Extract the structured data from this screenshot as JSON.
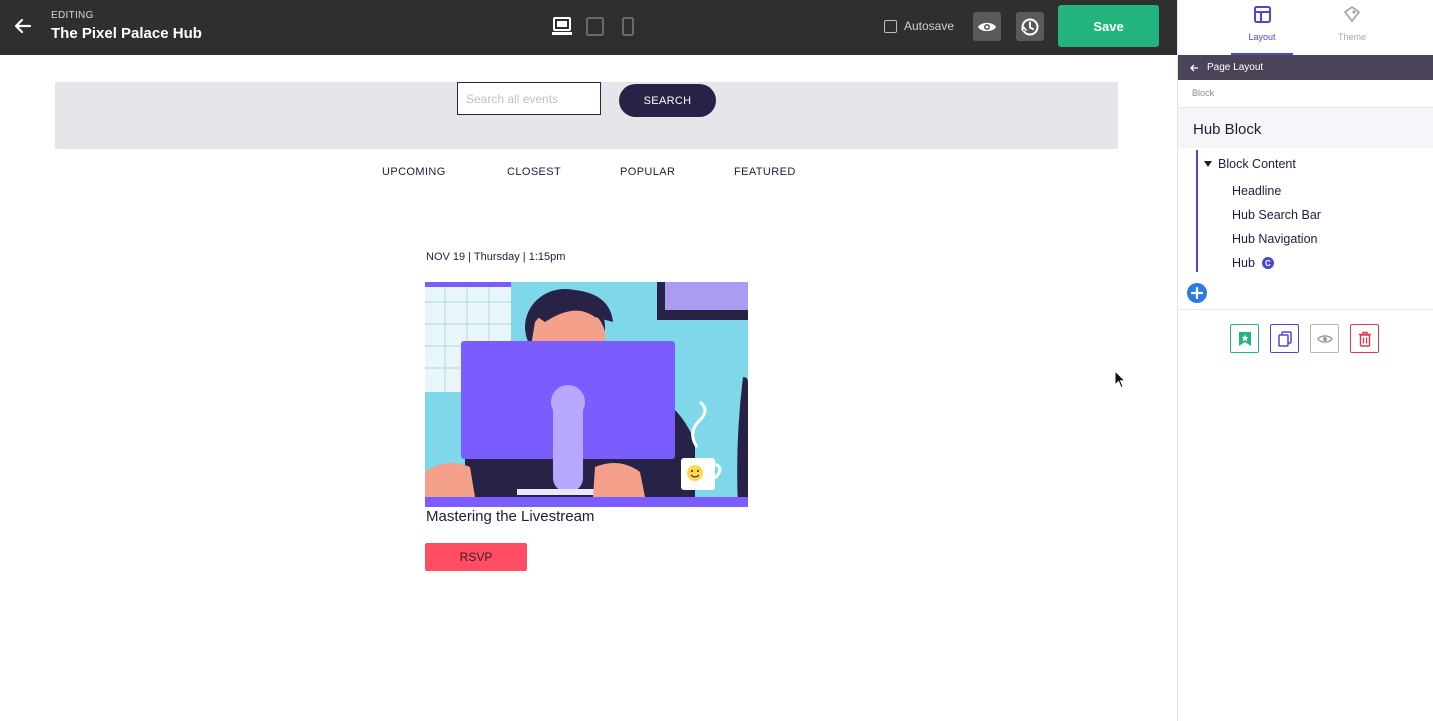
{
  "topbar": {
    "editing_label": "EDITING",
    "site_title": "The Pixel Palace Hub",
    "autosave_label": "Autosave",
    "save_label": "Save"
  },
  "canvas": {
    "search": {
      "placeholder": "Search all events",
      "button_label": "SEARCH"
    },
    "nav": [
      "UPCOMING",
      "CLOSEST",
      "POPULAR",
      "FEATURED"
    ],
    "event": {
      "date": "NOV 19 | Thursday | 1:15pm",
      "title": "Mastering the Livestream",
      "rsvp_label": "RSVP"
    }
  },
  "panel": {
    "tabs": [
      {
        "label": "Layout",
        "active": true
      },
      {
        "label": "Theme",
        "active": false
      }
    ],
    "breadcrumb": "Page Layout",
    "section_label": "Block",
    "block_title": "Hub Block",
    "tree_parent": "Block Content",
    "tree_items": [
      "Headline",
      "Hub Search Bar",
      "Hub Navigation",
      "Hub"
    ],
    "hub_badge": "C"
  },
  "colors": {
    "topbar": "#2f2f2f",
    "save": "#24b47e",
    "accent": "#4a4ad0",
    "search_button": "#262346",
    "rsvp": "#ff4d63",
    "crumb_bar": "#4b4458"
  }
}
